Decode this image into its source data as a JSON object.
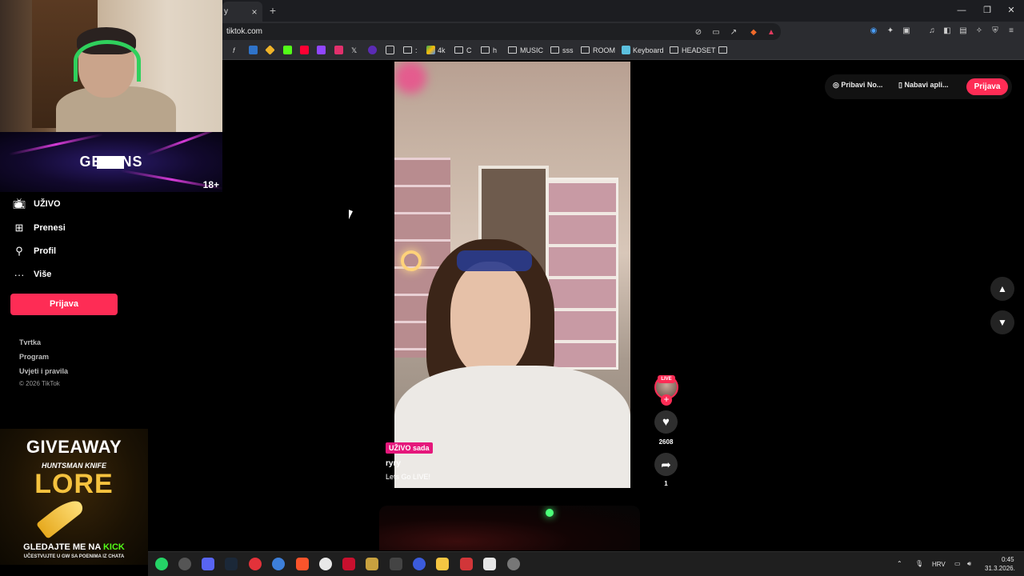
{
  "browser": {
    "tab_title": "y",
    "tab_close": "×",
    "new_tab": "+",
    "url": "tiktok.com",
    "window_controls": {
      "minimize": "—",
      "restore": "❐",
      "close": "✕"
    },
    "bookmarks": [
      {
        "label": "4k"
      },
      {
        "label": "C"
      },
      {
        "label": "h"
      },
      {
        "label": "MUSIC"
      },
      {
        "label": "sss"
      },
      {
        "label": "ROOM"
      },
      {
        "label": "Keyboard"
      },
      {
        "label": "HEADSET"
      }
    ]
  },
  "stream_overlay": {
    "banner_text": "GET INS",
    "age_badge": "18+",
    "giveaway": {
      "title": "GIVEAWAY",
      "subtitle": "HUNTSMAN KNIFE",
      "item": "LORE",
      "watch_prefix": "GLEDAJTE ME NA ",
      "watch_platform": "KICK",
      "note": "UČESTVUJTE U GW SA POENIMA IZ CHATA"
    }
  },
  "sidebar": {
    "items": [
      {
        "label": "UŽIVO",
        "icon": "live-tv-icon"
      },
      {
        "label": "Prenesi",
        "icon": "upload-icon"
      },
      {
        "label": "Profil",
        "icon": "profile-icon"
      },
      {
        "label": "Više",
        "icon": "more-icon"
      }
    ],
    "login_button": "Prijava",
    "footer_links": [
      "Tvrtka",
      "Program",
      "Uvjeti i pravila"
    ],
    "copyright": "© 2026 TikTok"
  },
  "top_actions": {
    "coins": "Pribavi No...",
    "app": "Nabavi apli...",
    "login": "Prijava"
  },
  "video": {
    "live_badge": "UŽIVO sada",
    "username": "ryry",
    "description": "Lets Go LIVE!",
    "avatar_badge": "LIVE",
    "likes": "2608",
    "shares": "1"
  },
  "taskbar": {
    "language": "HRV",
    "time": "0:45",
    "date": "31.3.2026."
  },
  "colors": {
    "accent": "#fe2c55",
    "live_badge": "#e5177b",
    "kick_green": "#53fc18"
  }
}
